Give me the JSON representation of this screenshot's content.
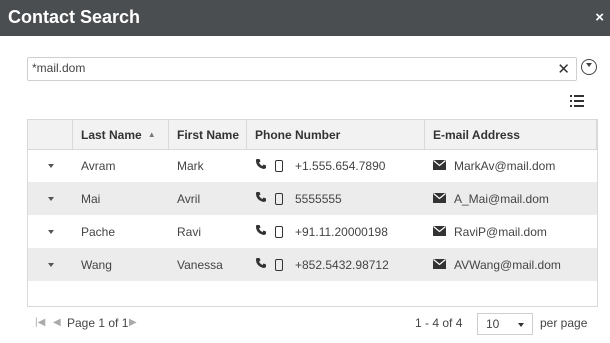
{
  "window": {
    "title": "Contact Search",
    "close_glyph": "×"
  },
  "search": {
    "value": "*mail.dom",
    "clear_glyph": "✕"
  },
  "grid": {
    "columns": [
      "Last Name",
      "First Name",
      "Phone Number",
      "E-mail Address"
    ],
    "sort_glyph": "▲",
    "rows": [
      {
        "last": "Avram",
        "first": "Mark",
        "phone": "+1.555.654.7890",
        "email": "MarkAv@mail.dom"
      },
      {
        "last": "Mai",
        "first": "Avril",
        "phone": "5555555",
        "email": "A_Mai@mail.dom"
      },
      {
        "last": "Pache",
        "first": "Ravi",
        "phone": "+91.11.20000198",
        "email": "RaviP@mail.dom"
      },
      {
        "last": "Wang",
        "first": "Vanessa",
        "phone": "+852.5432.98712",
        "email": "AVWang@mail.dom"
      }
    ]
  },
  "pager": {
    "first_glyph": "|◀",
    "prev_glyph": "◀",
    "next_glyph": "▶",
    "page_label": "Page 1 of 1",
    "count": "1 - 4 of 4",
    "page_size": "10",
    "per_page": "per page"
  },
  "icons": [
    "close-icon",
    "clear-icon",
    "expand-icon",
    "list-view-icon",
    "sort-asc-icon",
    "caret-down-icon",
    "phone-icon",
    "mobile-icon",
    "mail-icon"
  ],
  "colors": {
    "titlebar": "#4a4e51",
    "row_alt": "#ececec",
    "header_bg": "#f2f2f2"
  }
}
